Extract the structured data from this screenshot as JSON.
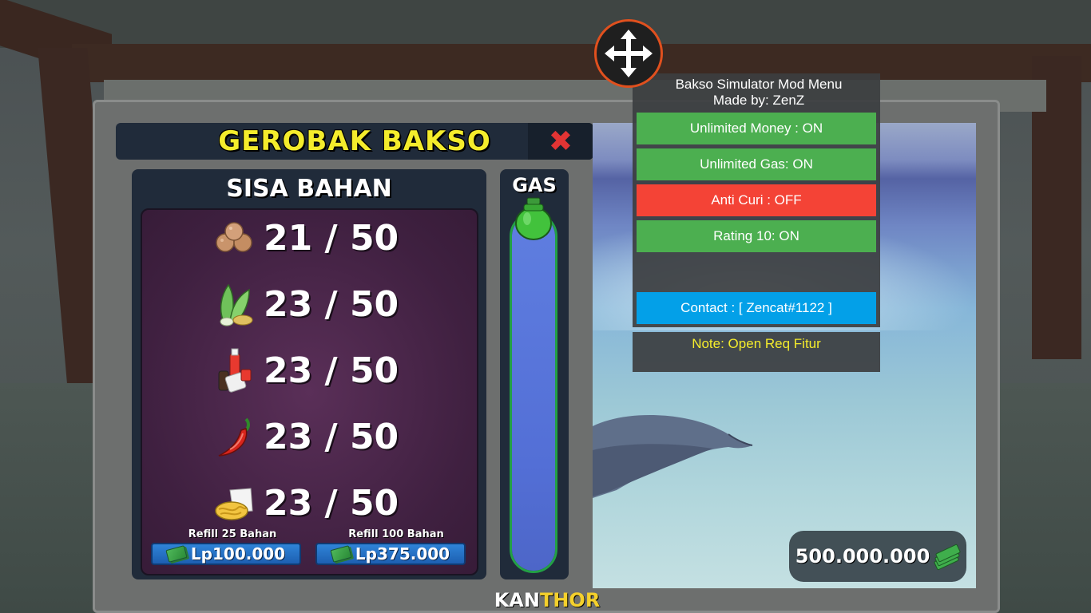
{
  "colors": {
    "title_yellow": "#f4ec2c",
    "close_red": "#e23434",
    "toggle_on": "#4caf50",
    "toggle_off": "#f44336",
    "contact_blue": "#03a0e8",
    "note_yellow": "#f4ec2c",
    "gas_green": "#23a045",
    "gas_fill": "#5f7ee0"
  },
  "cart": {
    "title": "GEROBAK BAKSO",
    "close_icon": "close-x-icon"
  },
  "ingredients": {
    "title": "SISA BAHAN",
    "items": [
      {
        "icon": "meatball-icon",
        "amount": "21 / 50"
      },
      {
        "icon": "vegetable-noodle-icon",
        "amount": "23 / 50"
      },
      {
        "icon": "sauce-bottles-icon",
        "amount": "23 / 50"
      },
      {
        "icon": "chili-pepper-icon",
        "amount": "23 / 50"
      },
      {
        "icon": "noodles-icon",
        "amount": "23 / 50"
      }
    ],
    "refill_small": {
      "label": "Refill 25 Bahan",
      "price": "Lp100.000"
    },
    "refill_large": {
      "label": "Refill 100 Bahan",
      "price": "Lp375.000"
    }
  },
  "gas": {
    "title": "GAS",
    "level_percent": 100
  },
  "money": {
    "balance": "500.000.000",
    "icon": "money-stack-icon"
  },
  "brand": {
    "part1": "KAN",
    "part2": "THOR"
  },
  "mod_menu": {
    "title_line1": "Bakso Simulator Mod Menu",
    "title_line2": "Made by: ZenZ",
    "toggles": [
      {
        "label": "Unlimited Money : ON",
        "state": "on"
      },
      {
        "label": "Unlimited Gas: ON",
        "state": "on"
      },
      {
        "label": "Anti Curi : OFF",
        "state": "off"
      },
      {
        "label": "Rating 10: ON",
        "state": "on"
      }
    ],
    "contact": "Contact : [ Zencat#1122 ]",
    "note": "Note: Open Req Fitur"
  }
}
